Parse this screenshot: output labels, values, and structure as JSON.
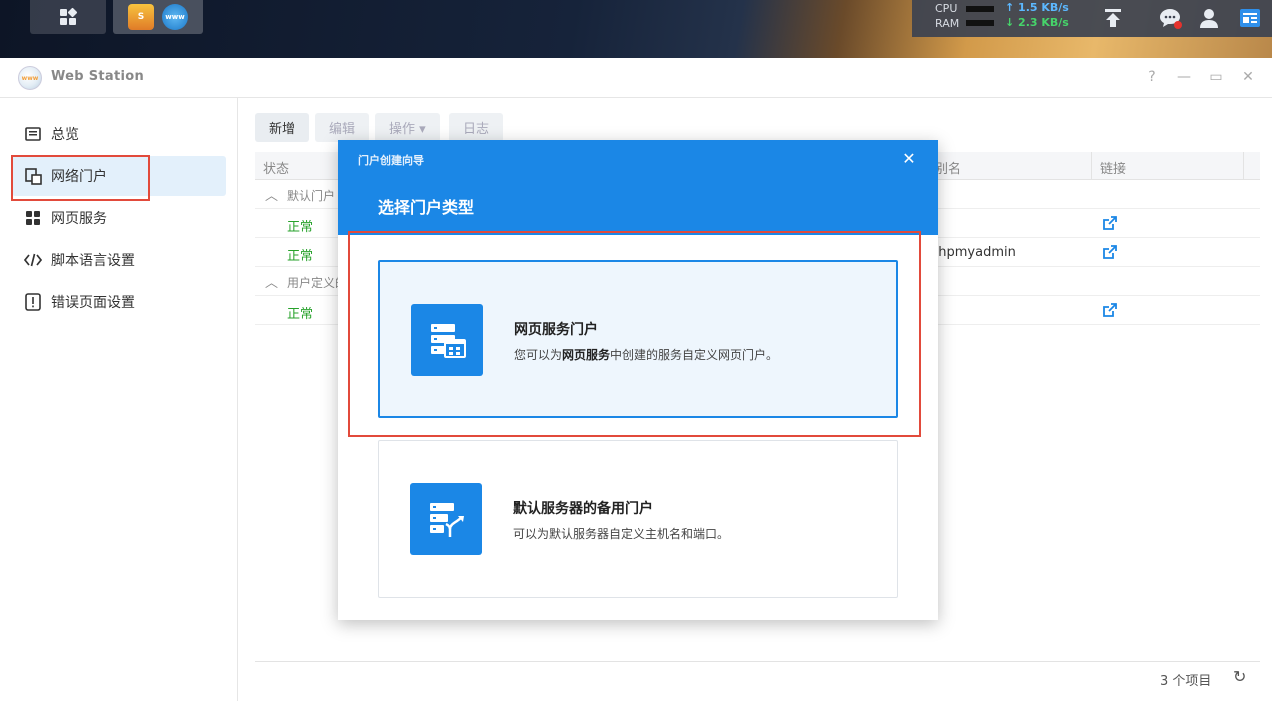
{
  "taskbar": {
    "cpu_label": "CPU",
    "ram_label": "RAM",
    "upload_speed": "1.5 KB/s",
    "download_speed": "2.3 KB/s",
    "app_s_letter": "S",
    "app_www_text": "www"
  },
  "window": {
    "title": "Web Station",
    "help": "?",
    "minimize": "—",
    "maximize": "▭",
    "close": "✕",
    "logo_text": "www"
  },
  "sidebar": {
    "items": [
      {
        "label": "总览",
        "icon": "overview-icon"
      },
      {
        "label": "网络门户",
        "icon": "portal-icon"
      },
      {
        "label": "网页服务",
        "icon": "grid-icon"
      },
      {
        "label": "脚本语言设置",
        "icon": "code-icon"
      },
      {
        "label": "错误页面设置",
        "icon": "error-icon"
      }
    ]
  },
  "toolbar": {
    "add": "新增",
    "edit": "编辑",
    "action": "操作 ▾",
    "log": "日志"
  },
  "table": {
    "headers": {
      "status": "状态",
      "alias": "别名",
      "link": "链接"
    },
    "group_default": "默认门户",
    "group_custom": "用户定义的",
    "rows": [
      {
        "status": "正常",
        "alias": ""
      },
      {
        "status": "正常",
        "alias": "phpmyadmin"
      },
      {
        "status": "正常",
        "alias": ""
      }
    ],
    "count": "3 个项目",
    "refresh": "↻"
  },
  "modal": {
    "small_title": "门户创建向导",
    "close": "✕",
    "heading": "选择门户类型",
    "cards": [
      {
        "title": "网页服务门户",
        "desc_pre": "您可以为",
        "desc_bold": "网页服务",
        "desc_post": "中创建的服务自定义网页门户。"
      },
      {
        "title": "默认服务器的备用门户",
        "desc": "可以为默认服务器自定义主机名和端口。"
      }
    ]
  },
  "colors": {
    "accent": "#1b87e6",
    "ok": "#27a22b",
    "highlight": "#e24a3b"
  }
}
